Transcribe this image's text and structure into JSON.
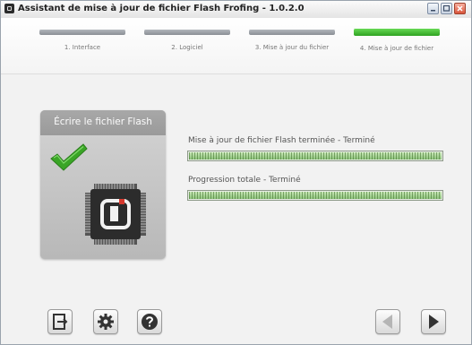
{
  "window": {
    "title": "Assistant de mise à jour de fichier Flash Frofing - 1.0.2.0"
  },
  "steps": [
    {
      "label": "1. Interface",
      "active": false
    },
    {
      "label": "2. Logiciel",
      "active": false
    },
    {
      "label": "3. Mise à jour du fichier",
      "active": false
    },
    {
      "label": "4. Mise à jour de fichier",
      "active": true
    }
  ],
  "flash_card": {
    "title": "Écrire le fichier Flash",
    "status_icon": "checkmark-icon",
    "device_icon": "chip-icon"
  },
  "progress": {
    "file_label": "Mise à jour de fichier Flash terminée - Terminé",
    "file_value": 1.0,
    "total_label": "Progression totale - Terminé",
    "total_value": 1.0
  },
  "toolbar": {
    "left_icons": [
      "exit-icon",
      "gear-icon",
      "help-icon"
    ],
    "nav_icons": [
      "back-arrow-icon",
      "next-arrow-icon"
    ]
  },
  "colors": {
    "active_step": "#2ea120",
    "checkmark": "#3aa526",
    "progress_fill": "#8cc27a"
  }
}
